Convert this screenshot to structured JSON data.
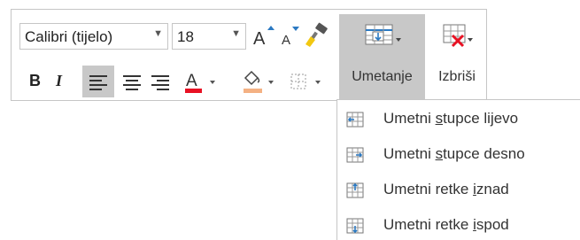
{
  "toolbar": {
    "font_name": "Calibri (tijelo)",
    "font_size": "18",
    "bold_label": "B",
    "italic_label": "I",
    "font_color_letter": "A",
    "grow_letter": "A",
    "shrink_letter": "A",
    "insert_label": "Umetanje",
    "delete_label": "Izbriši",
    "font_color_hex": "#e81123",
    "highlight_color_hex": "#f4b183"
  },
  "insert_menu": {
    "items": [
      {
        "pre": "Umetni ",
        "key": "s",
        "post": "tupce lijevo",
        "icon": "insert-columns-left-icon"
      },
      {
        "pre": "Umetni ",
        "key": "s",
        "post": "tupce desno",
        "icon": "insert-columns-right-icon"
      },
      {
        "pre": "Umetni retke ",
        "key": "i",
        "post": "znad",
        "icon": "insert-rows-above-icon"
      },
      {
        "pre": "Umetni retke ",
        "key": "i",
        "post": "spod",
        "icon": "insert-rows-below-icon"
      }
    ]
  },
  "colors": {
    "accent_blue": "#2b79c2",
    "selected_gray": "#c8c8c8",
    "border_gray": "#c6c6c6",
    "delete_red": "#e81123"
  }
}
